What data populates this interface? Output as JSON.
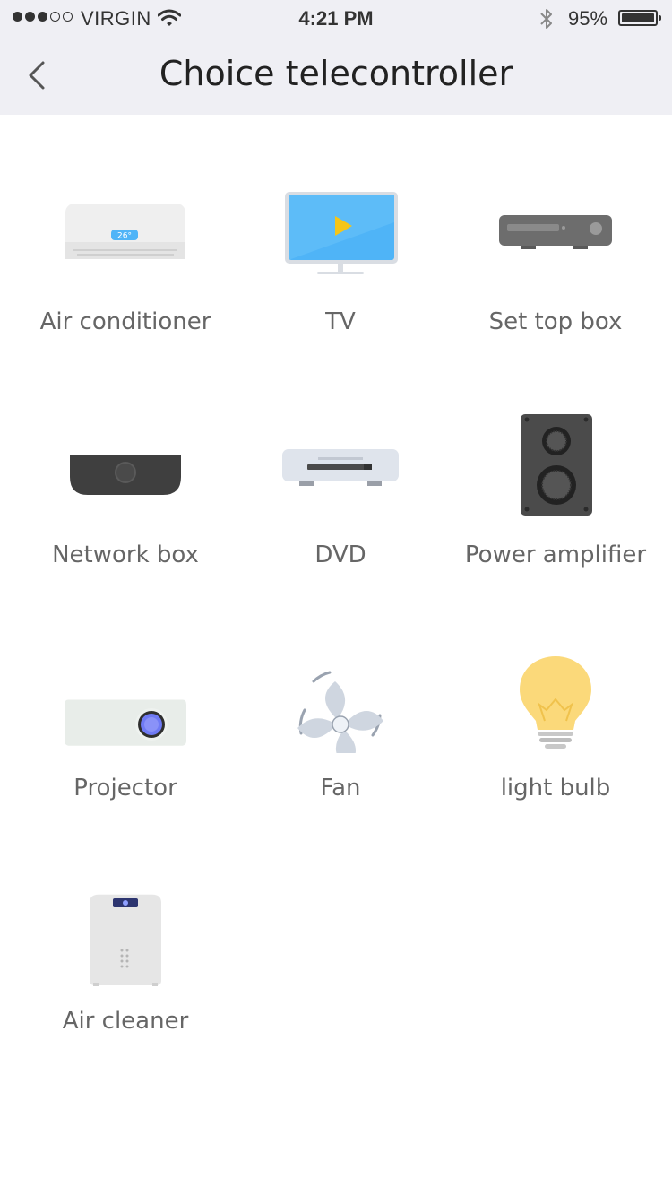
{
  "status_bar": {
    "carrier": "VIRGIN",
    "time": "4:21 PM",
    "battery_pct": "95%",
    "signal_bars_filled": 3,
    "signal_bars_total": 5
  },
  "nav": {
    "title": "Choice telecontroller",
    "back_icon": "chevron-left-icon"
  },
  "devices": [
    {
      "label": "Air conditioner",
      "icon": "air-conditioner-icon",
      "display": "26°"
    },
    {
      "label": "TV",
      "icon": "tv-icon"
    },
    {
      "label": "Set top box",
      "icon": "set-top-box-icon"
    },
    {
      "label": "Network box",
      "icon": "network-box-icon"
    },
    {
      "label": "DVD",
      "icon": "dvd-icon"
    },
    {
      "label": "Power amplifier",
      "icon": "speaker-icon"
    },
    {
      "label": "Projector",
      "icon": "projector-icon"
    },
    {
      "label": "Fan",
      "icon": "fan-icon"
    },
    {
      "label": "light bulb",
      "icon": "light-bulb-icon"
    },
    {
      "label": "Air cleaner",
      "icon": "air-cleaner-icon"
    }
  ],
  "colors": {
    "nav_bg": "#efeff4",
    "tv_screen": "#4fb4f7",
    "play": "#f5c518",
    "bulb": "#fbd97a"
  }
}
